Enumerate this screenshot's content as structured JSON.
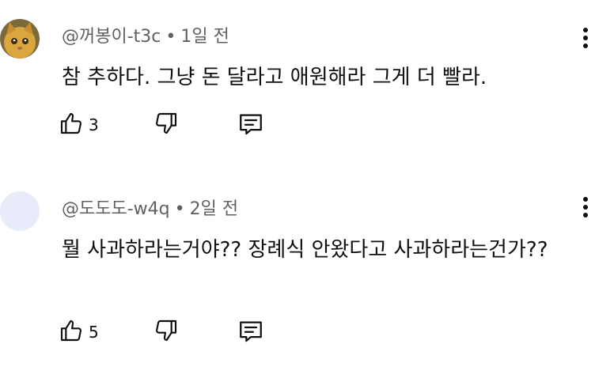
{
  "comments": [
    {
      "author": "@꺼봉이-t3c",
      "separator": "•",
      "time": "1일 전",
      "text": "참 추하다. 그냥 돈 달라고 애원해라 그게 더 빨라.",
      "likes": "3",
      "avatar": "cat-photo-avatar"
    },
    {
      "author": "@도도도-w4q",
      "separator": "•",
      "time": "2일 전",
      "text": "뭘 사과하라는거야?? 장례식 안왔다고 사과하라는건가??",
      "likes": "5",
      "avatar": "blank-avatar"
    }
  ],
  "icons": {
    "like": "thumbs-up-icon",
    "dislike": "thumbs-down-icon",
    "reply": "reply-comment-icon",
    "more": "more-vertical-icon"
  },
  "colors": {
    "background": "#ffffff",
    "text": "#0f0f0f",
    "meta": "#606060",
    "blank_avatar": "#e8ebfa"
  }
}
